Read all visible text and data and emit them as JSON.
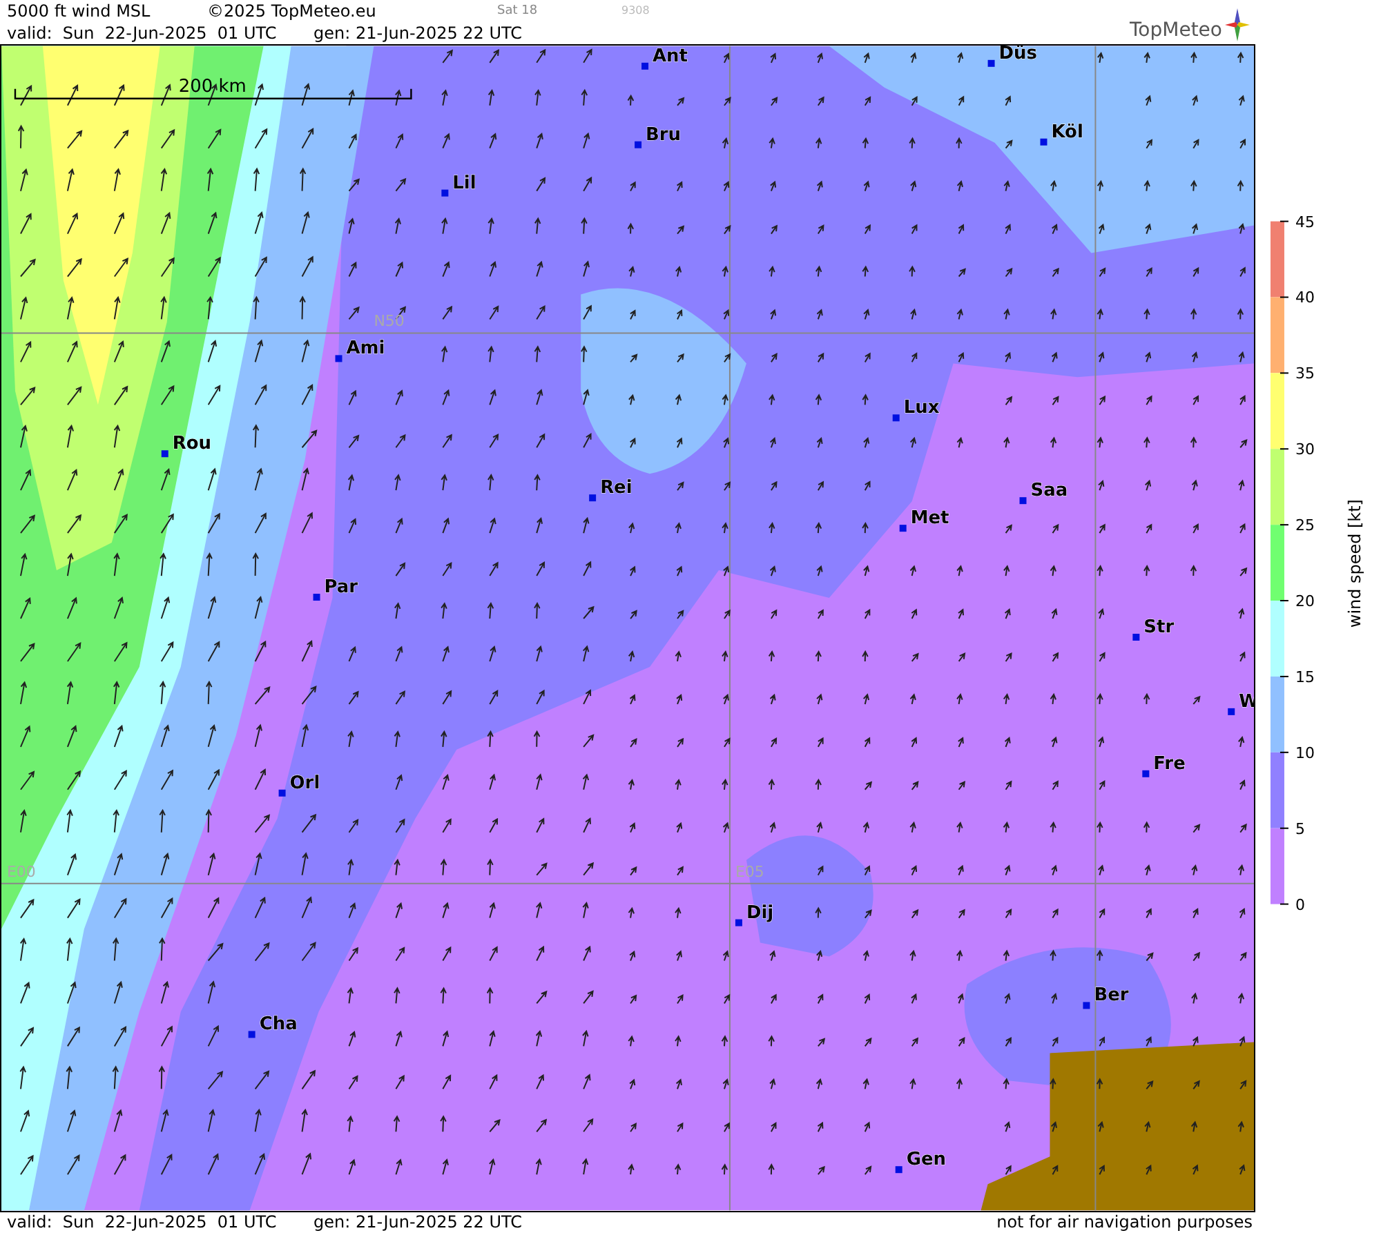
{
  "header": {
    "title": "5000 ft wind MSL",
    "copyright": "©2025 TopMeteo.eu",
    "day": "Sat 18",
    "code": "9308",
    "valid": "valid:  Sun  22-Jun-2025  01 UTC",
    "generated": "gen: 21-Jun-2025 22 UTC",
    "logo": "TopMeteo"
  },
  "map": {
    "scale_label": "200 km",
    "grid_labels": [
      "N50",
      "E00",
      "E05"
    ],
    "cities": [
      "Ant",
      "Düs",
      "Bru",
      "Köl",
      "Lil",
      "Ami",
      "Lux",
      "Rou",
      "Rei",
      "Saa",
      "Met",
      "Par",
      "Str",
      "W",
      "Fre",
      "Orl",
      "Dij",
      "Ber",
      "Cha",
      "Gen"
    ]
  },
  "legend": {
    "title": "wind speed [kt]",
    "ticks": [
      "45",
      "40",
      "35",
      "30",
      "25",
      "20",
      "15",
      "10",
      "5",
      "0"
    ],
    "bands": [
      {
        "color": "#f08070"
      },
      {
        "color": "#ffb070"
      },
      {
        "color": "#ffff70"
      },
      {
        "color": "#c0ff70"
      },
      {
        "color": "#70ff70"
      },
      {
        "color": "#b0ffff"
      },
      {
        "color": "#90c0ff"
      },
      {
        "color": "#9080ff"
      },
      {
        "color": "#c080ff"
      }
    ]
  },
  "footer": {
    "valid": "valid:  Sun  22-Jun-2025  01 UTC",
    "generated": "gen: 21-Jun-2025 22 UTC",
    "disclaimer": "not for air navigation purposes"
  }
}
